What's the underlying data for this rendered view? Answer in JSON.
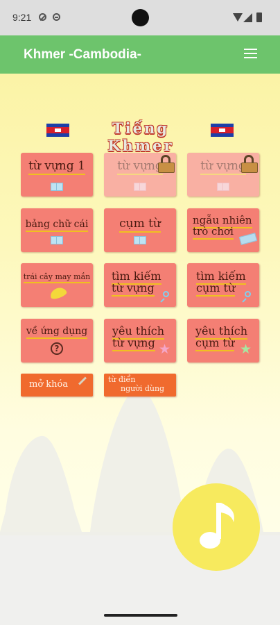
{
  "status_bar": {
    "time": "9:21"
  },
  "app_bar": {
    "title": "Khmer -Cambodia-"
  },
  "heading": {
    "title": "Tiếng Khmer"
  },
  "tiles": [
    {
      "label": "từ vựng 1",
      "icon": "book-icon",
      "locked": false
    },
    {
      "label": "từ vựng",
      "icon": "book-icon",
      "locked": true
    },
    {
      "label": "từ vựng",
      "icon": "book-icon",
      "locked": true
    },
    {
      "label": "bảng chữ cái",
      "icon": "book-icon",
      "locked": false
    },
    {
      "label": "cụm từ",
      "icon": "book-icon",
      "locked": false
    },
    {
      "label_line1": "ngẫu nhiên",
      "label_line2": "trò chơi",
      "icon": "ticket-icon",
      "locked": false
    },
    {
      "label": "trái cây may mắn",
      "icon": "banana-icon",
      "locked": false
    },
    {
      "label_line1": "tìm kiếm",
      "label_line2": "từ vựng",
      "icon": "search-icon",
      "locked": false
    },
    {
      "label_line1": "tìm kiếm",
      "label_line2": "cụm từ",
      "icon": "search-icon",
      "locked": false
    },
    {
      "label": "về ứng dụng",
      "icon": "help-icon",
      "locked": false
    },
    {
      "label_line1": "yêu thích",
      "label_line2": "từ vựng",
      "icon": "star-icon",
      "star_color": "#f4a6c8",
      "locked": false
    },
    {
      "label_line1": "yêu thích",
      "label_line2": "cụm từ",
      "icon": "star-icon",
      "star_color": "#a8e6a0",
      "locked": false
    }
  ],
  "buttons": {
    "unlock": "mở khóa",
    "dictionary_line1": "từ điển",
    "dictionary_line2": "người dùng"
  },
  "icons": {
    "help_glyph": "?",
    "star_glyph": "★"
  },
  "colors": {
    "app_bar": "#6dc46c",
    "tile": "#f47f74",
    "tile_locked": "#f9b0a3",
    "button_orange": "#f06a2e",
    "fab": "#f7ea5e"
  }
}
